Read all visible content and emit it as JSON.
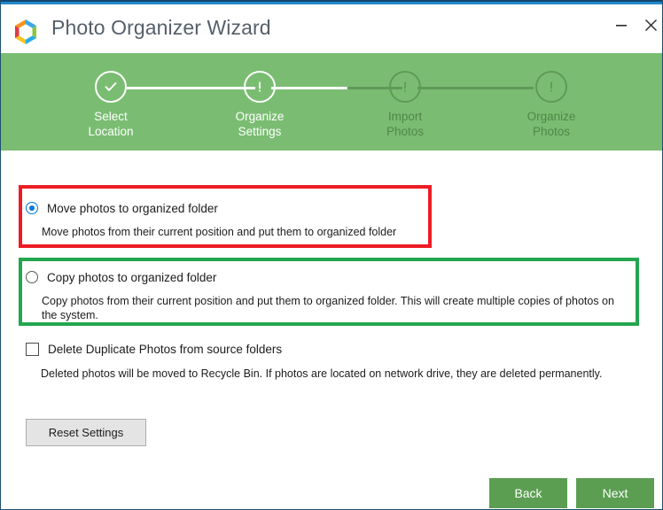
{
  "window": {
    "title": "Photo Organizer Wizard",
    "logo_icon": "hexagon-ring-logo-icon",
    "accent_color_dark": "#11486f",
    "accent_color_light": "#2489c8",
    "controls": {
      "minimize_icon": "minimize-icon",
      "minimize_glyph": "—",
      "close_icon": "close-icon",
      "close_glyph": "✕"
    }
  },
  "stepbar": {
    "background_color": "#7abd72",
    "active_color": "#ffffff",
    "inactive_color": "#5f9a58",
    "steps": [
      {
        "line1": "Select",
        "line2": "Location",
        "state": "complete",
        "icon": "check-icon",
        "glyph": "✓"
      },
      {
        "line1": "Organize",
        "line2": "Settings",
        "state": "current",
        "icon": "exclamation-icon",
        "glyph": "!"
      },
      {
        "line1": "Import",
        "line2": "Photos",
        "state": "pending",
        "icon": "exclamation-icon",
        "glyph": "!"
      },
      {
        "line1": "Organize",
        "line2": "Photos",
        "state": "pending",
        "icon": "exclamation-icon",
        "glyph": "!"
      }
    ]
  },
  "options": {
    "move": {
      "title": "Move photos to organized folder",
      "description": "Move photos from their current position and put them to organized folder",
      "selected": true,
      "highlight_color": "#ed1c24"
    },
    "copy": {
      "title": "Copy photos to organized folder",
      "description": "Copy photos from their current position and put them to organized folder. This will create multiple copies of photos on the system.",
      "selected": false,
      "highlight_color": "#22a64e"
    },
    "delete_duplicates": {
      "title": "Delete Duplicate Photos from source folders",
      "description": "Deleted photos will be moved to Recycle Bin. If photos are located on network drive, they are deleted permanently.",
      "checked": false
    }
  },
  "buttons": {
    "reset": "Reset Settings",
    "back": "Back",
    "next": "Next",
    "nav_color": "#5b9e52"
  }
}
